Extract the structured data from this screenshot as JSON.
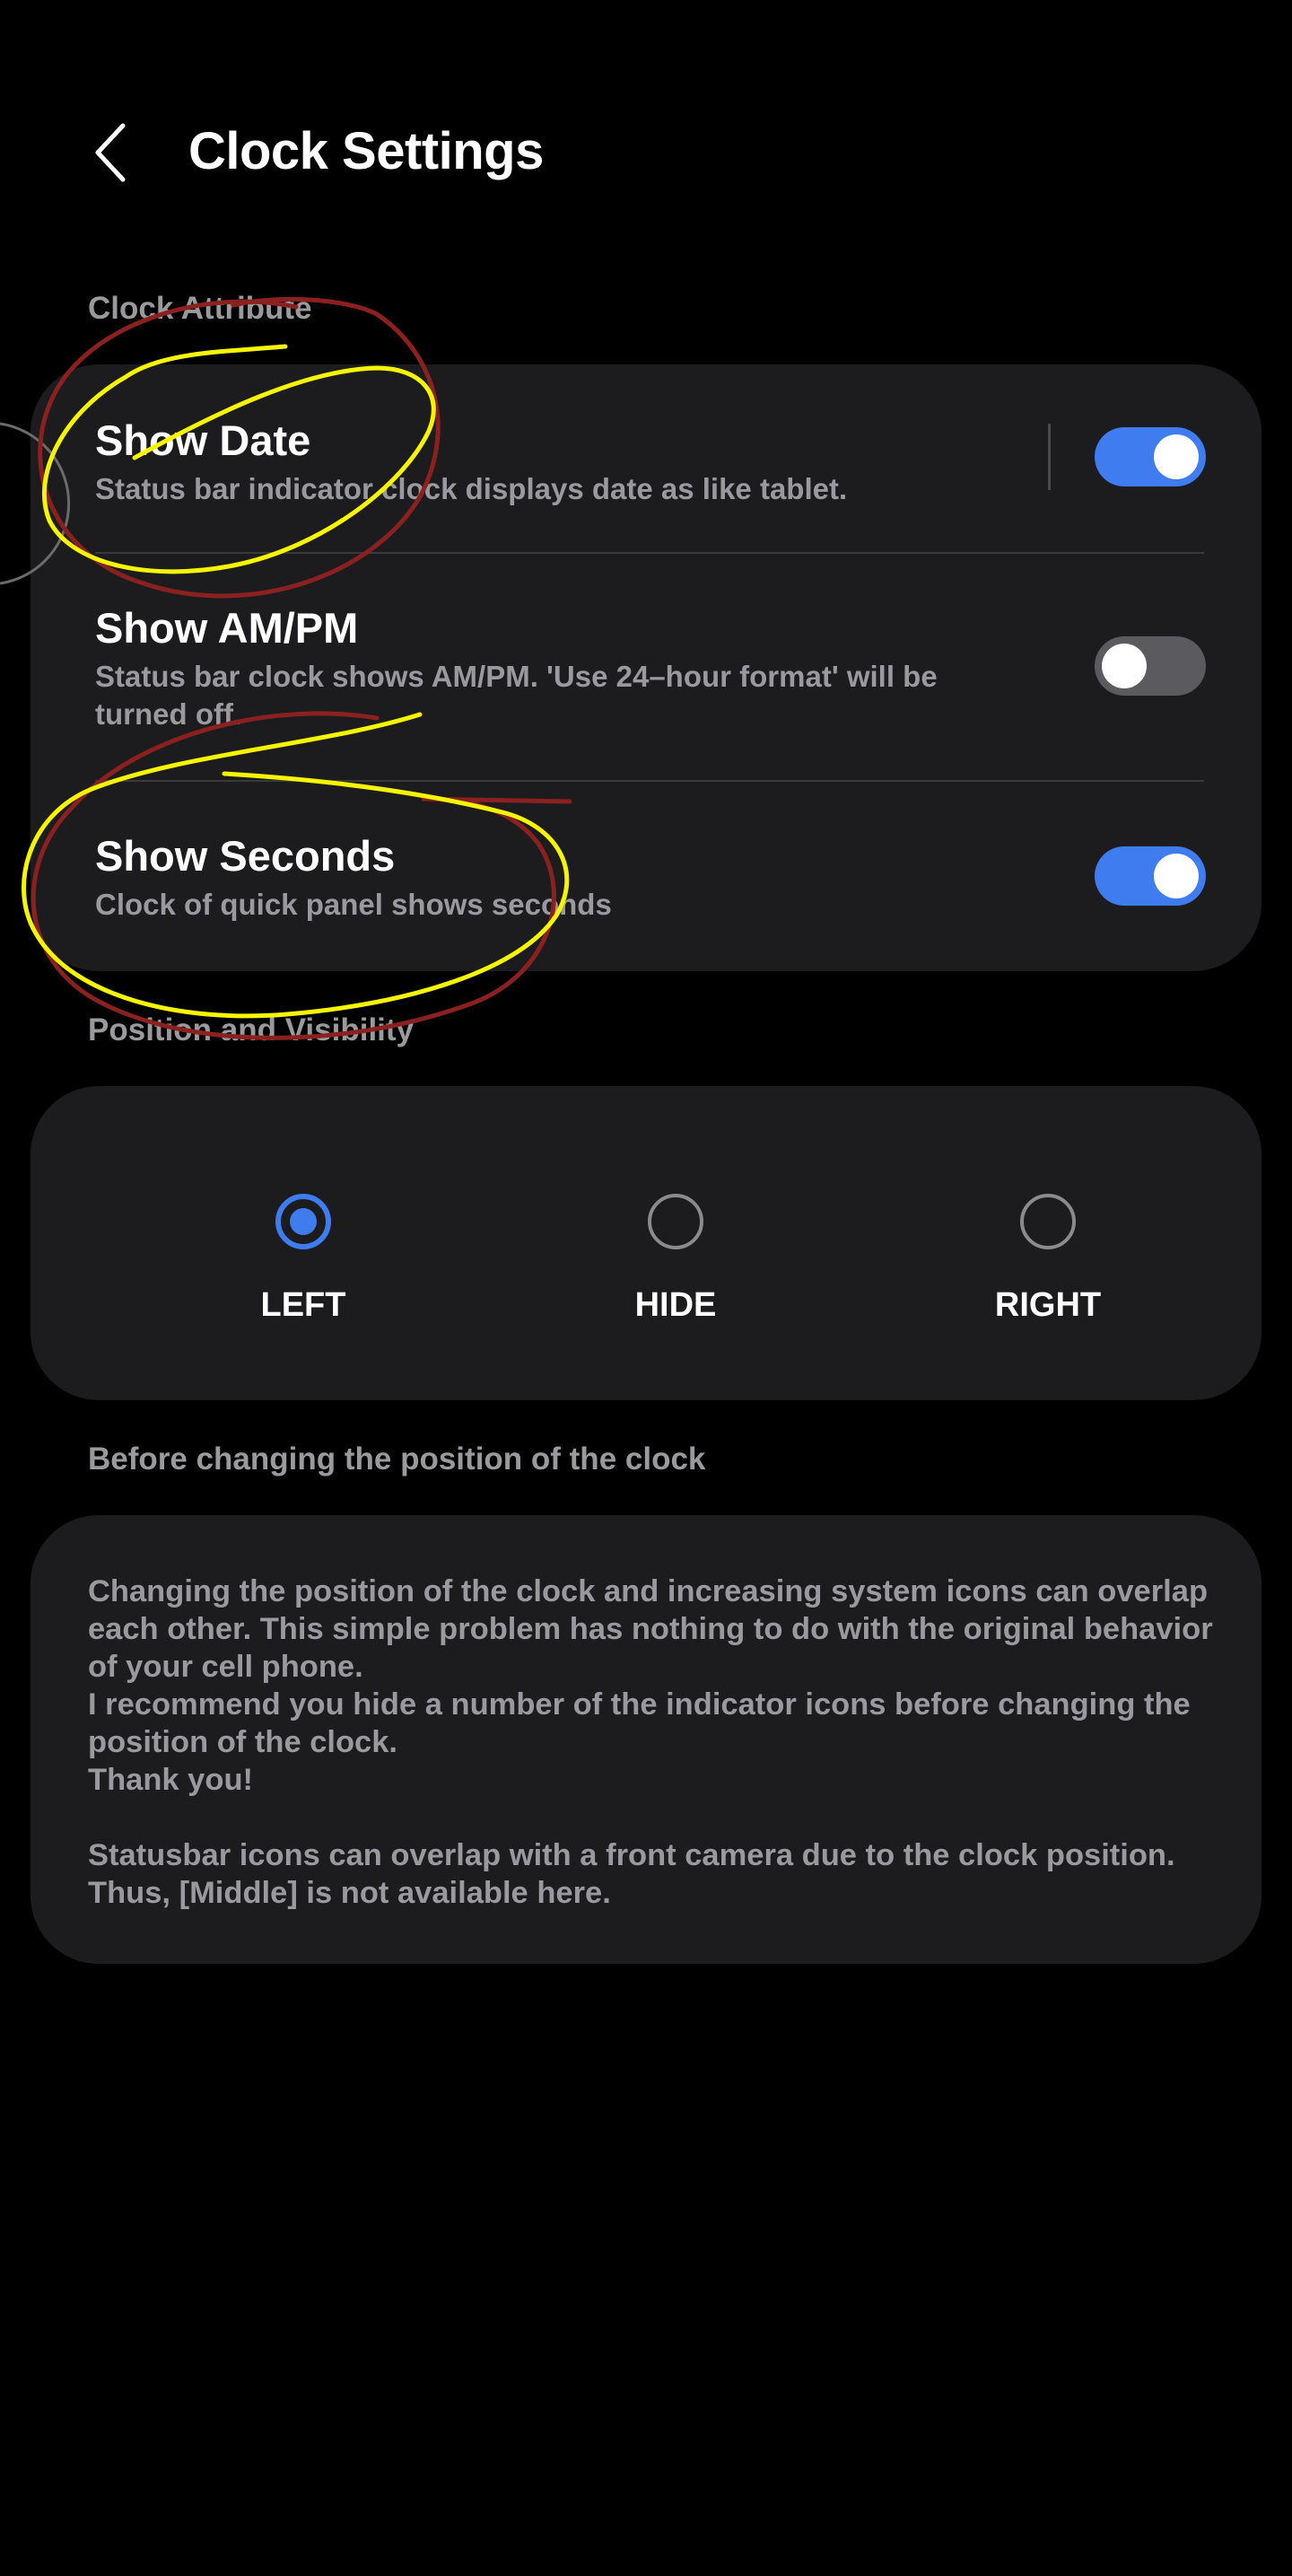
{
  "header": {
    "back_icon": "chevron-left-icon",
    "title": "Clock Settings"
  },
  "sections": {
    "clock_attribute_label": "Clock Attribute",
    "position_label": "Position and Visibility",
    "before_changing_label": "Before changing the position of the clock"
  },
  "clock_attribute": {
    "rows": [
      {
        "title": "Show Date",
        "subtitle": "Status bar indicator clock displays date as like tablet.",
        "enabled": true
      },
      {
        "title": "Show AM/PM",
        "subtitle": "Status bar clock shows AM/PM. 'Use 24–hour format' will be turned off.",
        "enabled": false
      },
      {
        "title": "Show Seconds",
        "subtitle": "Clock of quick panel shows seconds",
        "enabled": true
      }
    ]
  },
  "position": {
    "options": [
      {
        "label": "LEFT",
        "selected": true
      },
      {
        "label": "HIDE",
        "selected": false
      },
      {
        "label": "RIGHT",
        "selected": false
      }
    ]
  },
  "info": {
    "text": "Changing the position of the clock and increasing system icons can overlap each other. This simple problem has nothing to do with the original behavior of your cell phone.\n I recommend you hide a number of the indicator icons before changing the position of the clock.\n Thank you!\n\nStatusbar icons can overlap with a front camera due to the clock position. Thus, [Middle] is not available here."
  },
  "colors": {
    "background": "#000000",
    "card": "#1c1c1e",
    "accent": "#3e7cf0",
    "secondary_text": "#9a9a9e",
    "annotation_yellow": "#f5f500",
    "annotation_red": "#8b2020"
  }
}
